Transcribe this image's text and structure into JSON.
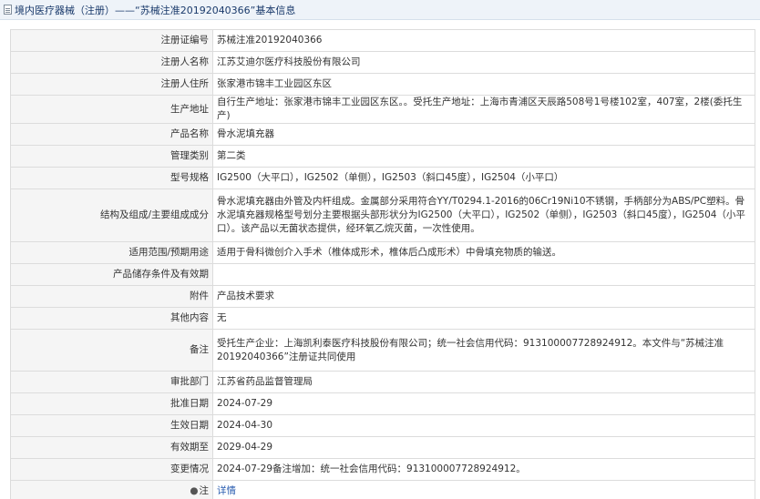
{
  "header": {
    "title": "境内医疗器械（注册）——“苏械注准20192040366”基本信息"
  },
  "rows": [
    {
      "label": "注册证编号",
      "value": "苏械注准20192040366"
    },
    {
      "label": "注册人名称",
      "value": "江苏艾迪尔医疗科技股份有限公司"
    },
    {
      "label": "注册人住所",
      "value": "张家港市锦丰工业园区东区"
    },
    {
      "label": "生产地址",
      "value": "自行生产地址：张家港市锦丰工业园区东区。。受托生产地址：上海市青浦区天辰路508号1号楼102室，407室，2楼(委托生产)"
    },
    {
      "label": "产品名称",
      "value": "骨水泥填充器"
    },
    {
      "label": "管理类别",
      "value": "第二类"
    },
    {
      "label": "型号规格",
      "value": "IG2500（大平口），IG2502（单侧），IG2503（斜口45度），IG2504（小平口）"
    },
    {
      "label": "结构及组成/主要组成成分",
      "value": "骨水泥填充器由外管及内杆组成。金属部分采用符合YY/T0294.1-2016的06Cr19Ni10不锈钢，手柄部分为ABS/PC塑料。骨水泥填充器规格型号划分主要根据头部形状分为IG2500（大平口），IG2502（单侧），IG2503（斜口45度），IG2504（小平口）。该产品以无菌状态提供，经环氧乙烷灭菌，一次性使用。"
    },
    {
      "label": "适用范围/预期用途",
      "value": "适用于骨科微创介入手术（椎体成形术，椎体后凸成形术）中骨填充物质的输送。"
    },
    {
      "label": "产品储存条件及有效期",
      "value": ""
    },
    {
      "label": "附件",
      "value": "产品技术要求"
    },
    {
      "label": "其他内容",
      "value": "无"
    },
    {
      "label": "备注",
      "value": "受托生产企业：上海凯利泰医疗科技股份有限公司；统一社会信用代码：913100007728924912。本文件与“苏械注准20192040366”注册证共同使用"
    },
    {
      "label": "审批部门",
      "value": "江苏省药品监督管理局"
    },
    {
      "label": "批准日期",
      "value": "2024-07-29"
    },
    {
      "label": "生效日期",
      "value": "2024-04-30"
    },
    {
      "label": "有效期至",
      "value": "2029-04-29"
    },
    {
      "label": "变更情况",
      "value": "2024-07-29备注增加：统一社会信用代码：913100007728924912。"
    }
  ],
  "note_row": {
    "bullet": "●",
    "label": "注",
    "link": "详情"
  }
}
